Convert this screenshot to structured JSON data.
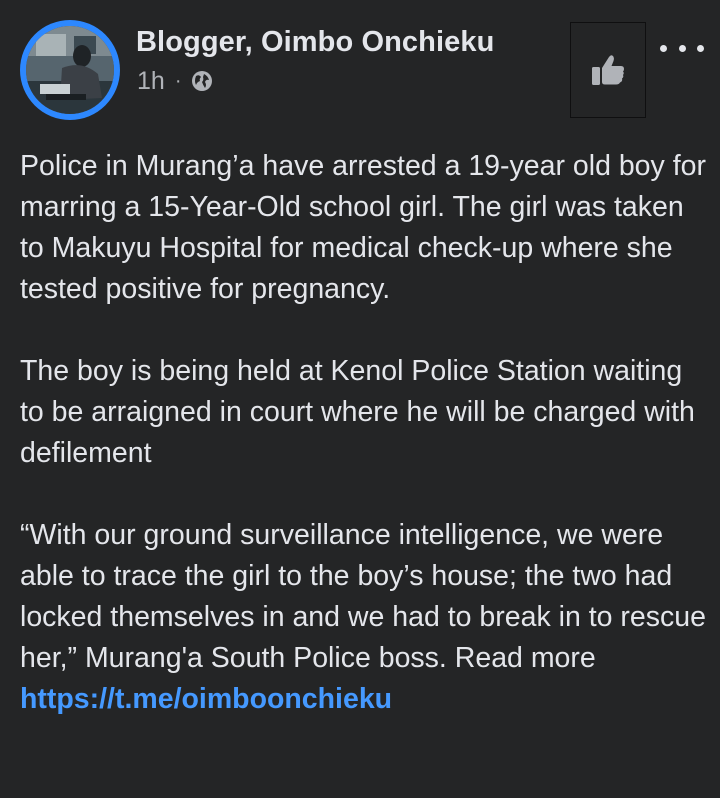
{
  "post": {
    "author": "Blogger, Oimbo Onchieku",
    "time": "1h",
    "separator": "·",
    "privacy_icon": "globe-icon",
    "like_icon": "thumbs-up-icon",
    "more_icon": "more-options-icon",
    "paragraph_1": "Police in Murang’a have arrested a 19-year old boy for marring a 15-Year-Old school girl. The girl was taken to Makuyu Hospital for medical check-up where she tested positive for pregnancy.",
    "paragraph_2": "The boy is being held at Kenol Police Station waiting to be arraigned in court where he will be charged with defilement",
    "paragraph_3": "“With our ground surveillance intelligence, we were able to trace the girl to the boy’s house; the two had locked themselves in and we had to break in to rescue her,” Murang'a South Police boss. Read more ",
    "link_text": "https://t.me/oimboonchieku"
  },
  "colors": {
    "background": "#242526",
    "text": "#e4e6eb",
    "secondary_text": "#b0b3b8",
    "link": "#4599ff",
    "avatar_ring": "#2d88ff"
  }
}
